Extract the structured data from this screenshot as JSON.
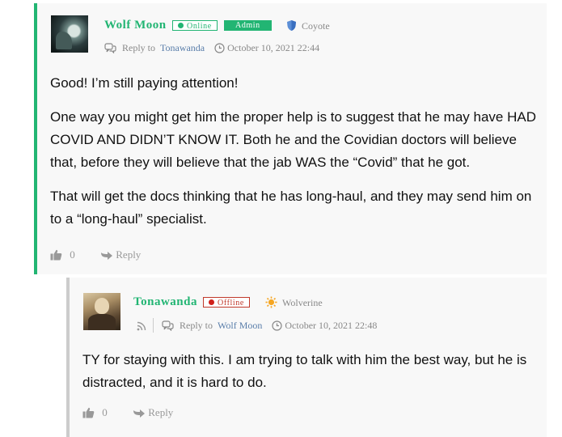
{
  "comments": [
    {
      "author": "Wolf Moon",
      "status": "Online",
      "role": "Admin",
      "rank": "Coyote",
      "reply_prefix": "Reply to",
      "reply_to": "Tonawanda",
      "date": "October 10, 2021 22:44",
      "paragraphs": [
        "Good! I’m still paying attention!",
        "One way you might get him the proper help is to suggest that he may have HAD COVID AND DIDN’T KNOW IT. Both he and the Covidian doctors will believe that, before they will believe that the jab WAS the “Covid” that he got.",
        "That will get the docs thinking that he has long-haul, and they may send him on to a “long-haul” specialist."
      ],
      "votes": "0",
      "reply_label": "Reply"
    },
    {
      "author": "Tonawanda",
      "status": "Offline",
      "rank": "Wolverine",
      "reply_prefix": "Reply to",
      "reply_to": "Wolf Moon",
      "date": "October 10, 2021 22:48",
      "paragraphs": [
        "TY for staying with this. I am trying to talk with him the best way, but he is distracted, and it is hard to do."
      ],
      "votes": "0",
      "reply_label": "Reply"
    }
  ],
  "colors": {
    "accent": "#22b573",
    "offline": "#c0392b",
    "link": "#5a7eaa"
  },
  "icons": {
    "rank1": "shield-icon",
    "rank2": "sun-icon",
    "reply_meta": "comment-bubbles-icon",
    "date": "clock-icon",
    "feed": "rss-icon",
    "vote": "thumbs-up-icon",
    "reply_action": "reply-arrow-icon"
  }
}
